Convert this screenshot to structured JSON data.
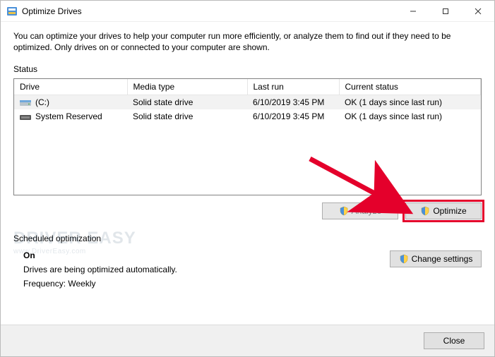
{
  "titlebar": {
    "title": "Optimize Drives"
  },
  "description": "You can optimize your drives to help your computer run more efficiently, or analyze them to find out if they need to be optimized. Only drives on or connected to your computer are shown.",
  "status_label": "Status",
  "table": {
    "headers": {
      "drive": "Drive",
      "media": "Media type",
      "lastrun": "Last run",
      "status": "Current status"
    },
    "rows": [
      {
        "name": "(C:)",
        "media": "Solid state drive",
        "lastrun": "6/10/2019 3:45 PM",
        "status": "OK (1 days since last run)",
        "icon": "drive"
      },
      {
        "name": "System Reserved",
        "media": "Solid state drive",
        "lastrun": "6/10/2019 3:45 PM",
        "status": "OK (1 days since last run)",
        "icon": "partition"
      }
    ]
  },
  "buttons": {
    "analyze": "Analyze",
    "optimize": "Optimize",
    "change_settings": "Change settings",
    "close": "Close"
  },
  "scheduled": {
    "label": "Scheduled optimization",
    "on": "On",
    "desc": "Drives are being optimized automatically.",
    "freq": "Frequency: Weekly"
  },
  "watermark": {
    "brand": "DRIVER EASY",
    "site": "www.DriverEasy.com"
  },
  "annotation": {
    "arrow_target": "optimize-button"
  }
}
